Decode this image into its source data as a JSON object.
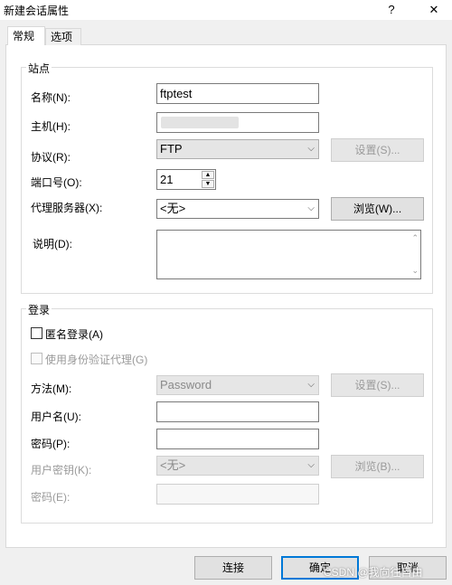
{
  "window": {
    "title": "新建会话属性",
    "help_glyph": "?",
    "close_glyph": "✕"
  },
  "tabs": [
    {
      "label": "常规",
      "active": true
    },
    {
      "label": "选项",
      "active": false
    }
  ],
  "site": {
    "group_title": "站点",
    "name_label": "名称(N):",
    "name_value": "ftptest",
    "host_label": "主机(H):",
    "protocol_label": "协议(R):",
    "protocol_value": "FTP",
    "protocol_settings_button": "设置(S)...",
    "port_label": "端口号(O):",
    "port_value": "21",
    "proxy_label": "代理服务器(X):",
    "proxy_value": "<无>",
    "proxy_browse_button": "浏览(W)...",
    "description_label": "说明(D):",
    "description_value": ""
  },
  "login": {
    "group_title": "登录",
    "anonymous_label": "匿名登录(A)",
    "anonymous_checked": false,
    "agent_label": "使用身份验证代理(G)",
    "agent_checked": false,
    "method_label": "方法(M):",
    "method_value": "Password",
    "method_settings_button": "设置(S)...",
    "username_label": "用户名(U):",
    "username_value": "",
    "password_label": "密码(P):",
    "password_value": "",
    "userkey_label": "用户密钥(K):",
    "userkey_value": "<无>",
    "userkey_browse_button": "浏览(B)...",
    "passphrase_label": "密码(E):",
    "passphrase_value": ""
  },
  "footer": {
    "connect_button": "连接",
    "ok_button": "确定",
    "cancel_button": "取消"
  },
  "watermark": "CSDN @我向往自由",
  "icons": {
    "dropdown": "chevron-down-icon",
    "spin_up": "spin-up-icon",
    "spin_down": "spin-down-icon"
  }
}
